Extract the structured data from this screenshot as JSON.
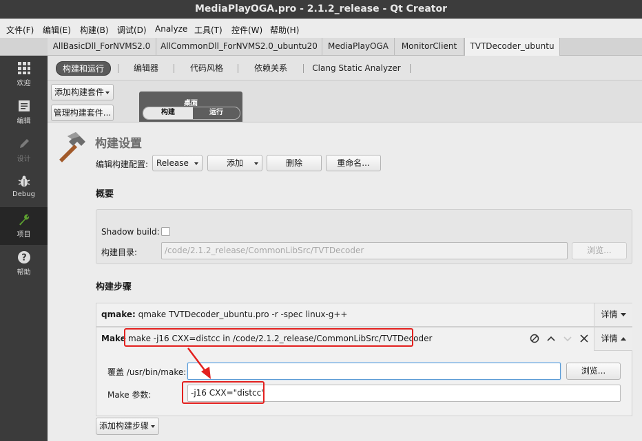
{
  "window": {
    "title": "MediaPlayOGA.pro - 2.1.2_release - Qt Creator"
  },
  "menu": [
    "文件(F)",
    "编辑(E)",
    "构建(B)",
    "调试(D)",
    "Analyze",
    "工具(T)",
    "控件(W)",
    "帮助(H)"
  ],
  "project_tabs": [
    "AllBasicDll_ForNVMS2.0",
    "AllCommonDll_ForNVMS2.0_ubuntu20",
    "MediaPlayOGA",
    "MonitorClient",
    "TVTDecoder_ubuntu"
  ],
  "modes": {
    "welcome": "欢迎",
    "edit": "编辑",
    "design": "设计",
    "debug": "Debug",
    "projects": "项目",
    "help": "帮助"
  },
  "subtabs": [
    "构建和运行",
    "编辑器",
    "代码风格",
    "依赖关系",
    "Clang Static Analyzer"
  ],
  "kit": {
    "add_kit": "添加构建套件",
    "manage_kits": "管理构建套件...",
    "name": "桌面",
    "build": "构建",
    "run": "运行"
  },
  "build_settings": {
    "title": "构建设置",
    "edit_config_label": "编辑构建配置:",
    "config_value": "Release",
    "add": "添加",
    "delete": "删除",
    "rename": "重命名..."
  },
  "overview": {
    "heading": "概要",
    "shadow_build_label": "Shadow build:",
    "build_dir_label": "构建目录:",
    "build_dir_value": "/code/2.1.2_release/CommonLibSrc/TVTDecoder",
    "browse": "浏览..."
  },
  "build_steps": {
    "heading": "构建步骤",
    "qmake_label": "qmake:",
    "qmake_cmd": "qmake TVTDecoder_ubuntu.pro -r -spec linux-g++",
    "details": "详情",
    "make_label": "Make",
    "make_cmd": "make -j16 CXX=distcc in /code/2.1.2_release/CommonLibSrc/TVTDecoder",
    "override_label": "覆盖 /usr/bin/make:",
    "override_value": "",
    "browse": "浏览...",
    "make_args_label": "Make 参数:",
    "make_args_value": "-j16 CXX=\"distcc\"",
    "add_step": "添加构建步骤"
  },
  "colors": {
    "annotation": "#e3201e",
    "sidebar": "#3b3b3b",
    "sidebar_active": "#262626",
    "accent_green": "#5da130"
  }
}
